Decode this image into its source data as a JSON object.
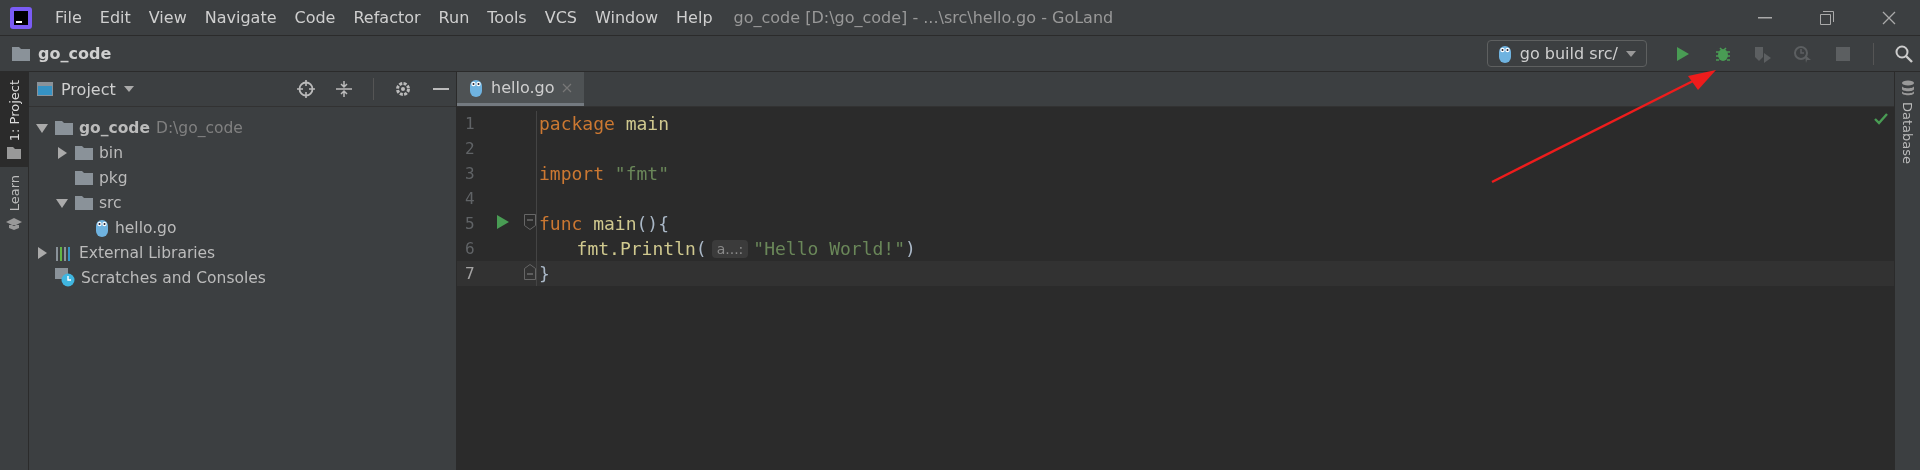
{
  "window": {
    "title": "go_code [D:\\go_code] - ...\\src\\hello.go - GoLand"
  },
  "menu": [
    "File",
    "Edit",
    "View",
    "Navigate",
    "Code",
    "Refactor",
    "Run",
    "Tools",
    "VCS",
    "Window",
    "Help"
  ],
  "navigation_bar": {
    "breadcrumb": "go_code",
    "run_configuration": "go build src/",
    "toolbar_buttons": [
      {
        "kind": "run",
        "disabled": false
      },
      {
        "kind": "debug",
        "disabled": false
      },
      {
        "kind": "coverage",
        "disabled": true
      },
      {
        "kind": "profile",
        "disabled": true
      },
      {
        "kind": "stop",
        "disabled": true
      }
    ]
  },
  "left_stripe": [
    {
      "label": "1: Project",
      "selected": true
    },
    {
      "label": "Learn",
      "selected": false
    }
  ],
  "right_stripe": [
    {
      "label": "Database"
    }
  ],
  "project_panel": {
    "title": "Project",
    "tree": [
      {
        "kind": "folder",
        "label": "go_code",
        "path": "D:\\go_code",
        "bold": true,
        "expanded": true,
        "children": [
          {
            "kind": "folder",
            "label": "bin",
            "expanded": false
          },
          {
            "kind": "folder",
            "label": "pkg"
          },
          {
            "kind": "folder",
            "label": "src",
            "expanded": true,
            "children": [
              {
                "kind": "file",
                "label": "hello.go"
              }
            ]
          }
        ]
      },
      {
        "kind": "libraries",
        "label": "External Libraries",
        "expanded": false
      },
      {
        "kind": "scratches",
        "label": "Scratches and Consoles"
      }
    ]
  },
  "editor": {
    "tabs": [
      {
        "label": "hello.go",
        "selected": true
      }
    ],
    "lines": [
      {
        "number": "1",
        "current": false,
        "tokens": [
          {
            "kind": "keyword",
            "text": "package"
          },
          {
            "kind": "name",
            "text": "main",
            "space_before": true
          }
        ]
      },
      {
        "number": "2",
        "current": false
      },
      {
        "number": "3",
        "current": false,
        "tokens": [
          {
            "kind": "keyword",
            "text": "import"
          },
          {
            "kind": "string",
            "text": "\"fmt\"",
            "space_before": true
          }
        ]
      },
      {
        "number": "4",
        "current": false
      },
      {
        "number": "5",
        "current": false,
        "run_marker": true,
        "fold_start": true,
        "tokens": [
          {
            "kind": "keyword",
            "text": "func"
          },
          {
            "kind": "name",
            "text": "main",
            "space_before": true
          },
          {
            "kind": "plain",
            "text": "(){"
          }
        ]
      },
      {
        "number": "6",
        "current": false,
        "indented": true,
        "tokens": [
          {
            "kind": "name",
            "text": "fmt.Println"
          },
          {
            "kind": "plain",
            "text": "("
          },
          {
            "kind": "hint",
            "text": "a...:"
          },
          {
            "kind": "string",
            "text": "\"Hello World!\""
          },
          {
            "kind": "plain",
            "text": ")"
          }
        ]
      },
      {
        "number": "7",
        "current": true,
        "fold_end": true,
        "tokens": [
          {
            "kind": "plain",
            "text": "}"
          }
        ]
      }
    ]
  }
}
